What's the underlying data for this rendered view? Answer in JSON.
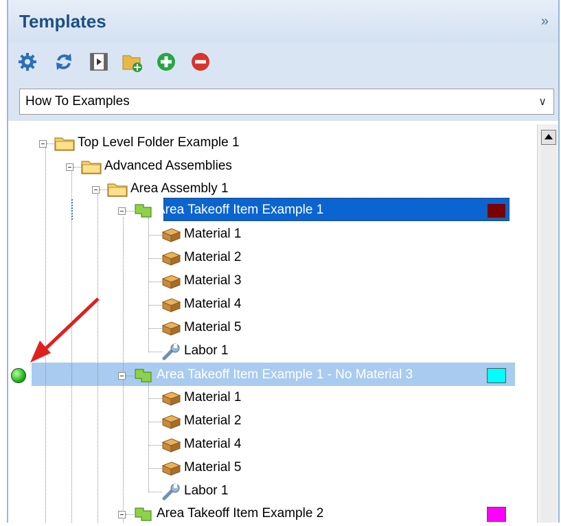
{
  "panel": {
    "title": "Templates",
    "collapse_label": "»"
  },
  "toolbar": {
    "buttons": [
      {
        "icon": "gear-icon"
      },
      {
        "icon": "refresh-icon"
      },
      {
        "icon": "filmstrip-icon"
      },
      {
        "icon": "new-folder-icon"
      },
      {
        "icon": "add-icon"
      },
      {
        "icon": "remove-icon"
      }
    ]
  },
  "dropdown": {
    "selected": "How To Examples",
    "arrow": "∨"
  },
  "tree": {
    "nodes": [
      {
        "label": "Top Level Folder Example 1",
        "icon": "folder-icon"
      },
      {
        "label": "Advanced Assemblies",
        "icon": "folder-icon"
      },
      {
        "label": "Area Assembly 1",
        "icon": "folder-icon"
      },
      {
        "label": "Area Takeoff Item Example 1",
        "icon": "area-takeoff-icon",
        "color": "#7a0000",
        "state": "selected"
      },
      {
        "label": "Material 1",
        "icon": "material-box-icon"
      },
      {
        "label": "Material 2",
        "icon": "material-box-icon"
      },
      {
        "label": "Material 3",
        "icon": "material-box-icon"
      },
      {
        "label": "Material 4",
        "icon": "material-box-icon"
      },
      {
        "label": "Material 5",
        "icon": "material-box-icon"
      },
      {
        "label": "Labor 1",
        "icon": "wrench-icon"
      },
      {
        "label": "Area Takeoff Item Example 1 -  No Material 3",
        "icon": "area-takeoff-icon",
        "color": "#00ffff",
        "state": "highlighted"
      },
      {
        "label": "Material 1",
        "icon": "material-box-icon"
      },
      {
        "label": "Material 2",
        "icon": "material-box-icon"
      },
      {
        "label": "Material 4",
        "icon": "material-box-icon"
      },
      {
        "label": "Material 5",
        "icon": "material-box-icon"
      },
      {
        "label": "Labor 1",
        "icon": "wrench-icon"
      },
      {
        "label": "Area Takeoff Item Example 2",
        "icon": "area-takeoff-icon",
        "color": "#ff00ff"
      }
    ]
  },
  "colors": {
    "title": "#1e4f86",
    "selection": "#0a64d2",
    "highlight": "#a9cbef",
    "annotation_arrow": "#e0201e",
    "status_dot": "#23b31e"
  }
}
